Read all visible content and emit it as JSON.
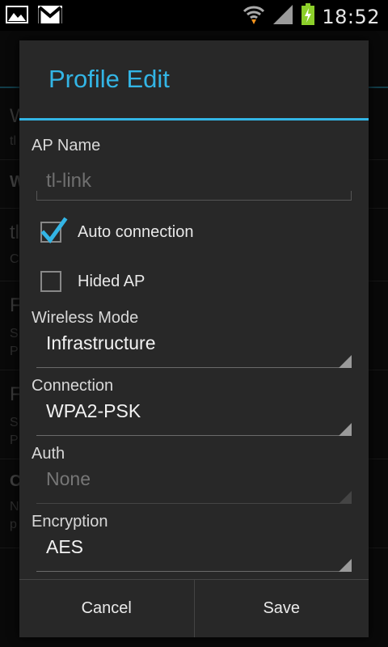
{
  "status_bar": {
    "time": "18:52",
    "icons": [
      "image-icon",
      "gmail-icon",
      "wifi-icon",
      "signal-icon",
      "battery-charging-icon"
    ]
  },
  "dialog": {
    "title": "Profile Edit",
    "ap_name": {
      "label": "AP Name",
      "placeholder": "tl-link",
      "value": ""
    },
    "auto_connection": {
      "label": "Auto connection",
      "checked": true
    },
    "hided_ap": {
      "label": "Hided AP",
      "checked": false
    },
    "wireless_mode": {
      "label": "Wireless Mode",
      "value": "Infrastructure"
    },
    "connection": {
      "label": "Connection",
      "value": "WPA2-PSK"
    },
    "auth": {
      "label": "Auth",
      "value": "None",
      "enabled": false
    },
    "encryption": {
      "label": "Encryption",
      "value": "AES"
    },
    "buttons": {
      "cancel": "Cancel",
      "save": "Save"
    }
  },
  "colors": {
    "accent": "#33b5e5",
    "dialog_bg": "#282828",
    "status_bar_bg": "#000000",
    "battery_green": "#8ccf2a"
  }
}
